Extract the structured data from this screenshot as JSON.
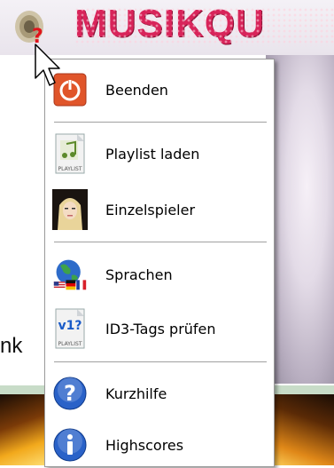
{
  "app": {
    "title": "MUSIKQU",
    "side_text": "nk"
  },
  "menu": {
    "items": [
      {
        "id": "quit",
        "label": "Beenden",
        "icon": "power-icon"
      },
      {
        "id": "load-playlist",
        "label": "Playlist laden",
        "icon": "playlist-icon",
        "icon_caption": "PLAYLIST"
      },
      {
        "id": "single-player",
        "label": "Einzelspieler",
        "icon": "player-portrait-icon"
      },
      {
        "id": "languages",
        "label": "Sprachen",
        "icon": "globe-flags-icon"
      },
      {
        "id": "check-id3",
        "label": "ID3-Tags prüfen",
        "icon": "id3-playlist-icon",
        "icon_caption": "PLAYLIST",
        "icon_badge": "v1?"
      },
      {
        "id": "quick-help",
        "label": "Kurzhilfe",
        "icon": "help-icon"
      },
      {
        "id": "highscores",
        "label": "Highscores",
        "icon": "info-icon"
      }
    ]
  },
  "colors": {
    "brand": "#d8245a",
    "power_button": "#e0552a",
    "help_blue": "#2a62c8"
  }
}
